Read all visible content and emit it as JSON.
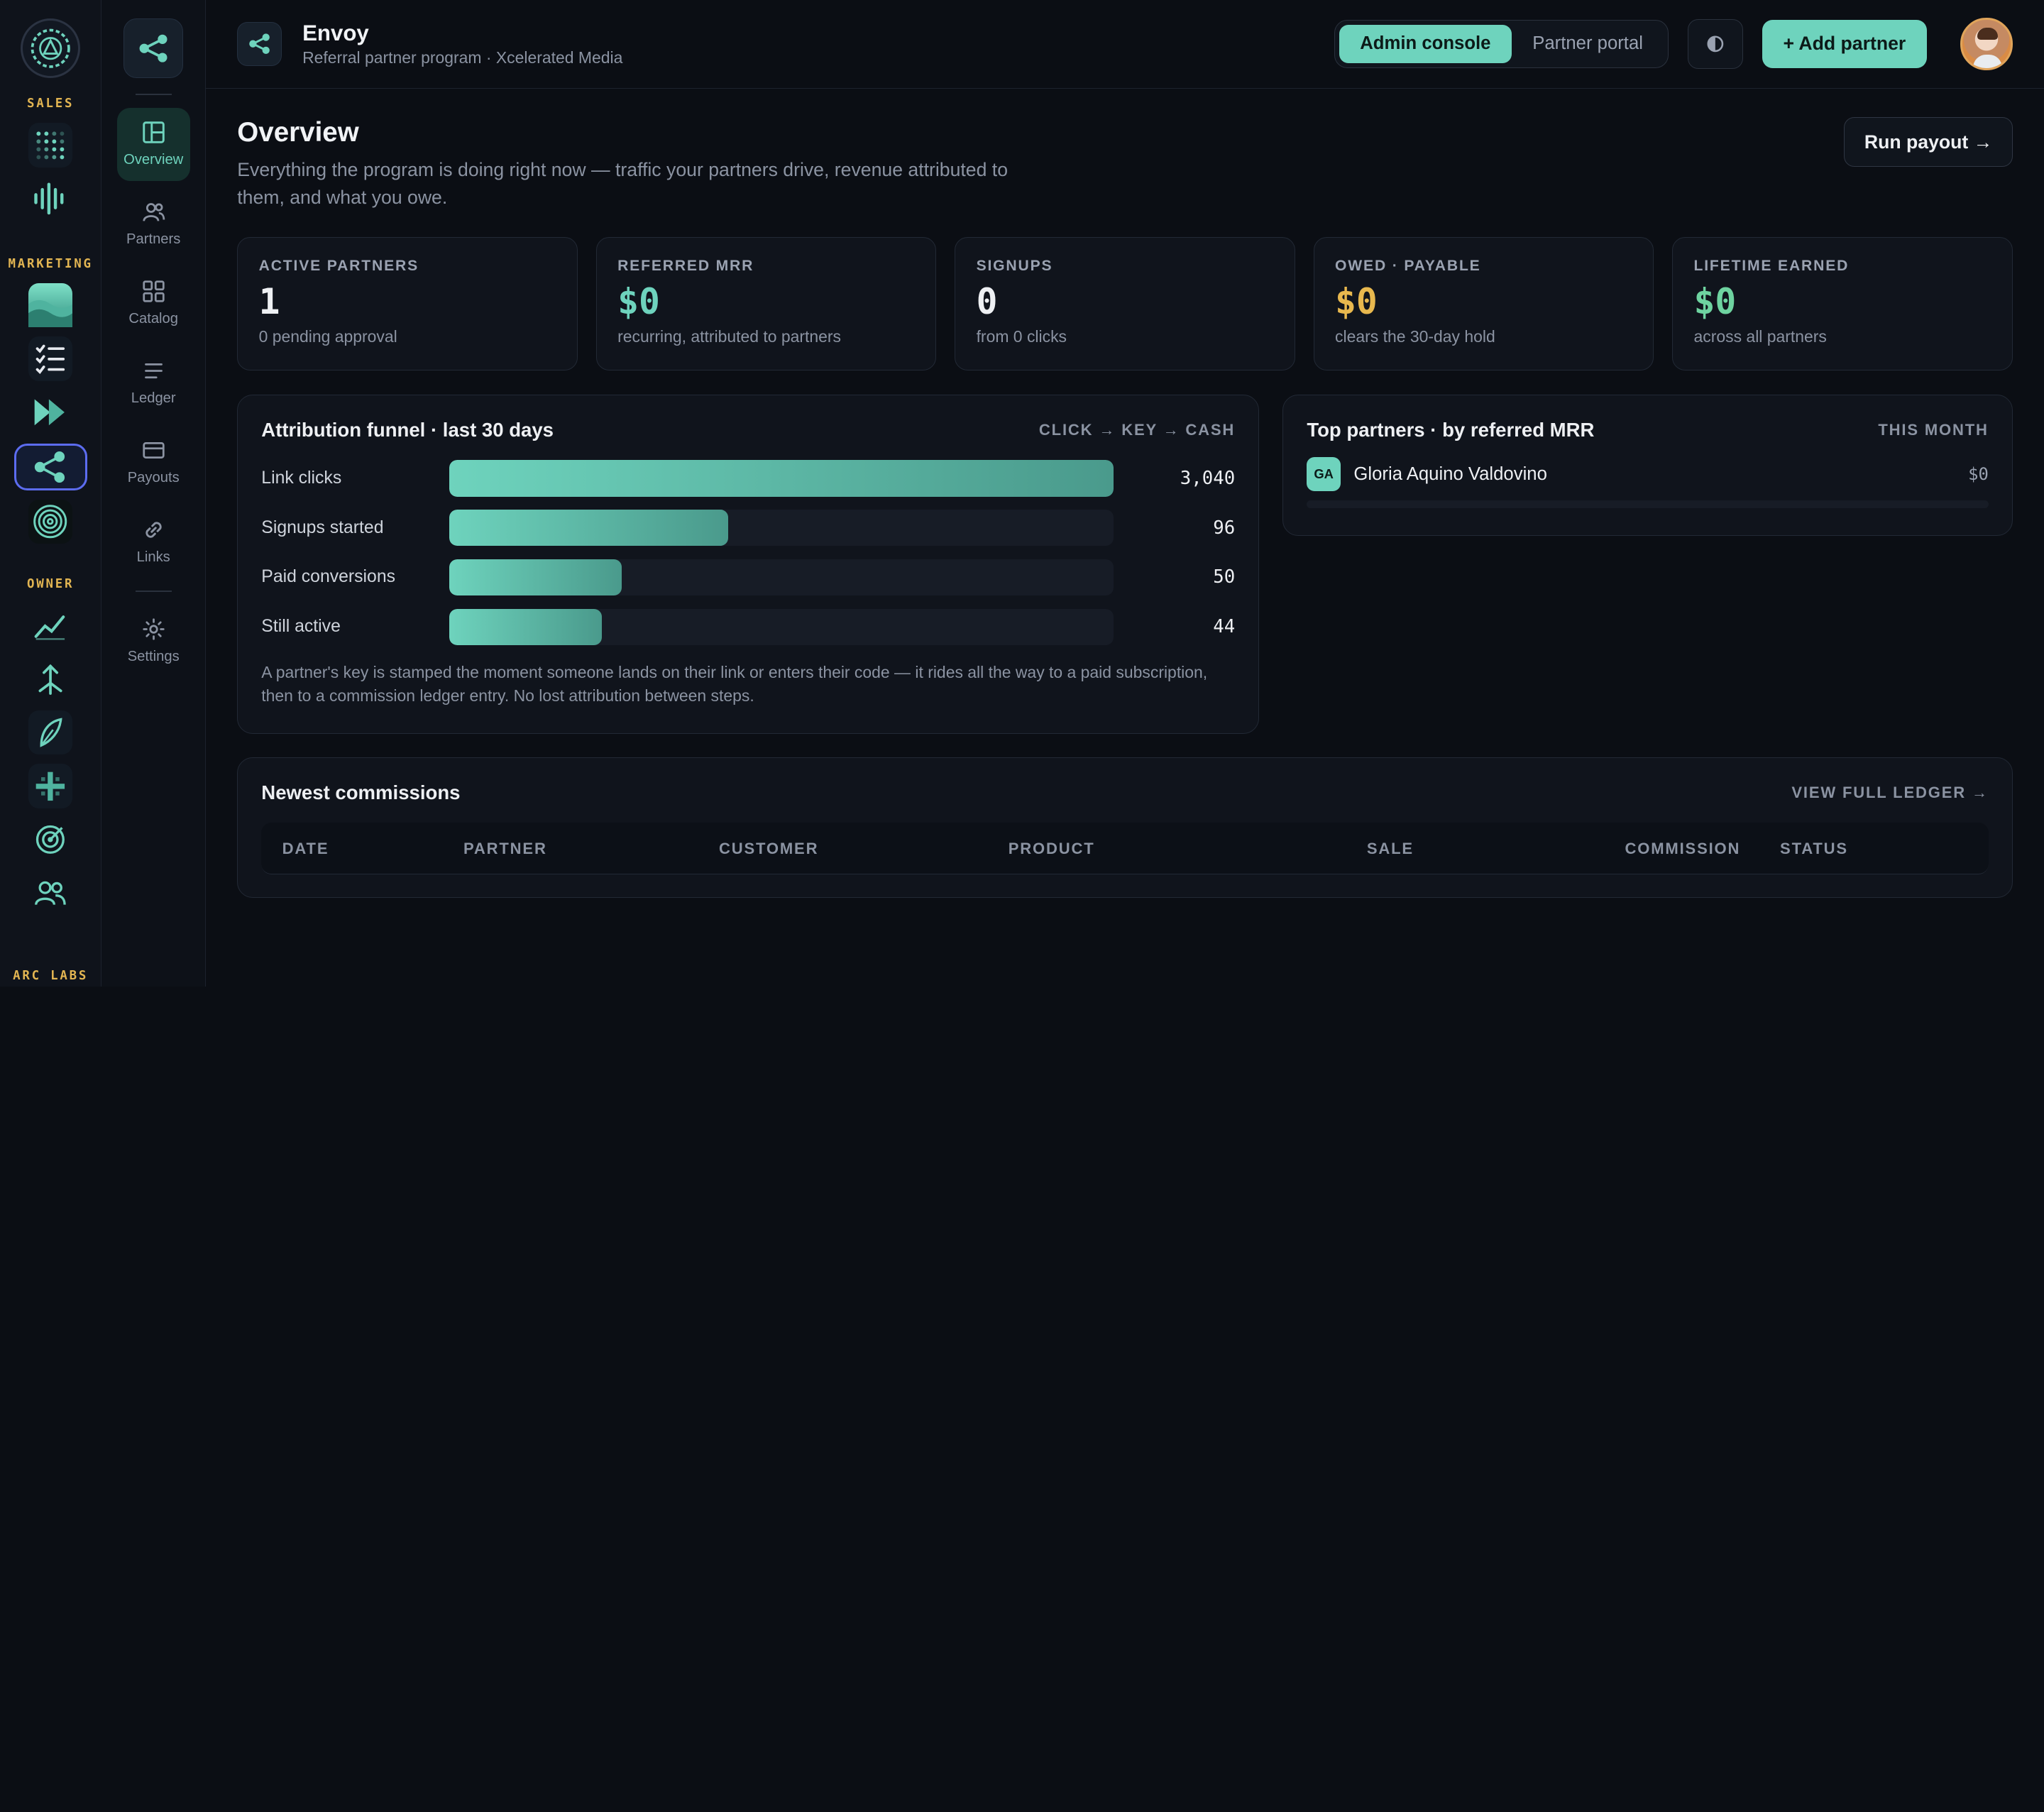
{
  "rail": {
    "sections": [
      "SALES",
      "MARKETING",
      "OWNER"
    ],
    "footer": "ARC LABS"
  },
  "sidebar": {
    "items": [
      {
        "label": "Overview",
        "icon": "layout-icon"
      },
      {
        "label": "Partners",
        "icon": "users-icon"
      },
      {
        "label": "Catalog",
        "icon": "grid-icon"
      },
      {
        "label": "Ledger",
        "icon": "list-icon"
      },
      {
        "label": "Payouts",
        "icon": "card-icon"
      },
      {
        "label": "Links",
        "icon": "link-icon"
      },
      {
        "label": "Settings",
        "icon": "gear-icon"
      }
    ]
  },
  "header": {
    "title": "Envoy",
    "subtitle": "Referral partner program · Xcelerated Media",
    "tabs": [
      "Admin console",
      "Partner portal"
    ],
    "active_tab": "Admin console",
    "add_label": "+ Add partner"
  },
  "overview": {
    "title": "Overview",
    "description": "Everything the program is doing right now — traffic your partners drive, revenue attributed to them, and what you owe.",
    "run_payout_label": "Run payout →"
  },
  "stats": [
    {
      "label": "ACTIVE PARTNERS",
      "value": "1",
      "note": "0 pending approval",
      "color": "#eef0f3"
    },
    {
      "label": "REFERRED MRR",
      "value": "$0",
      "note": "recurring, attributed to partners",
      "color": "#6ed3bd"
    },
    {
      "label": "SIGNUPS",
      "value": "0",
      "note": "from 0 clicks",
      "color": "#eef0f3"
    },
    {
      "label": "OWED · PAYABLE",
      "value": "$0",
      "note": "clears the 30-day hold",
      "color": "#e8b84e"
    },
    {
      "label": "LIFETIME EARNED",
      "value": "$0",
      "note": "across all partners",
      "color": "#6ed3a0"
    }
  ],
  "funnel": {
    "title": "Attribution funnel · last 30 days",
    "meta": "CLICK → KEY → CASH",
    "rows": [
      {
        "label": "Link clicks",
        "value": "3,040",
        "fraction": 1.0
      },
      {
        "label": "Signups started",
        "value": "96",
        "fraction": 0.42
      },
      {
        "label": "Paid conversions",
        "value": "50",
        "fraction": 0.26
      },
      {
        "label": "Still active",
        "value": "44",
        "fraction": 0.23
      }
    ],
    "footnote": "A partner's key is stamped the moment someone lands on their link or enters their code — it rides all the way to a paid subscription, then to a commission ledger entry. No lost attribution between steps."
  },
  "top_partners": {
    "title": "Top partners · by referred MRR",
    "meta": "THIS MONTH",
    "rows": [
      {
        "initials": "GA",
        "name": "Gloria Aquino Valdovino",
        "amount": "$0",
        "fraction": 0.0
      }
    ]
  },
  "commissions": {
    "title": "Newest commissions",
    "link": "VIEW FULL LEDGER →",
    "columns": [
      "DATE",
      "PARTNER",
      "CUSTOMER",
      "PRODUCT",
      "SALE",
      "COMMISSION",
      "STATUS"
    ]
  }
}
